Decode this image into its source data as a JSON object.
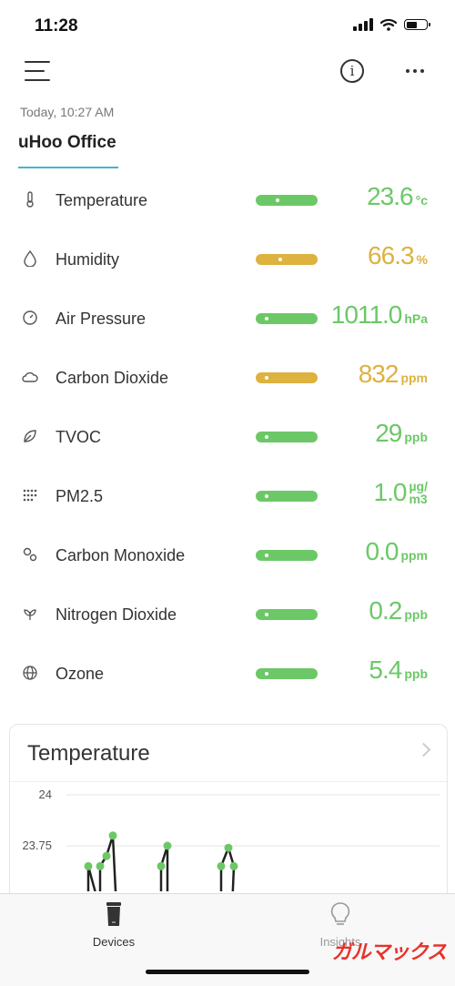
{
  "status_bar": {
    "time": "11:28"
  },
  "header": {
    "timestamp": "Today, 10:27 AM",
    "device_name": "uHoo Office"
  },
  "colors": {
    "green": "#6cc867",
    "yellow": "#ddb23f",
    "accent": "#41b6cf"
  },
  "metrics": [
    {
      "label": "Temperature",
      "value": "23.6",
      "unit": "°c",
      "status": "good",
      "icon": "thermometer-icon",
      "level": 0.3
    },
    {
      "label": "Humidity",
      "value": "66.3",
      "unit": "%",
      "status": "moderate",
      "icon": "droplet-icon",
      "level": 0.35
    },
    {
      "label": "Air Pressure",
      "value": "1011.0",
      "unit": "hPa",
      "status": "good",
      "icon": "gauge-icon",
      "level": 0.1
    },
    {
      "label": "Carbon Dioxide",
      "value": "832",
      "unit": "ppm",
      "status": "moderate",
      "icon": "cloud-icon",
      "level": 0.1
    },
    {
      "label": "TVOC",
      "value": "29",
      "unit": "ppb",
      "status": "good",
      "icon": "leaf-icon",
      "level": 0.1
    },
    {
      "label": "PM2.5",
      "value": "1.0",
      "unit": "µg/ m3",
      "unit_top": "µg/",
      "unit_bottom": "m3",
      "status": "good",
      "icon": "particles-icon",
      "level": 0.1
    },
    {
      "label": "Carbon Monoxide",
      "value": "0.0",
      "unit": "ppm",
      "status": "good",
      "icon": "molecule-icon",
      "level": 0.1
    },
    {
      "label": "Nitrogen Dioxide",
      "value": "0.2",
      "unit": "ppb",
      "status": "good",
      "icon": "plant-icon",
      "level": 0.1
    },
    {
      "label": "Ozone",
      "value": "5.4",
      "unit": "ppb",
      "status": "good",
      "icon": "globe-icon",
      "level": 0.1
    }
  ],
  "chart_card": {
    "title": "Temperature",
    "y_ticks": [
      "24",
      "23.75"
    ]
  },
  "chart_data": {
    "type": "line",
    "title": "Temperature",
    "xlabel": "",
    "ylabel": "",
    "ylim": [
      23.5,
      24
    ],
    "grid": true,
    "points": [
      {
        "x": 0,
        "y": 23.65
      },
      {
        "x": 1,
        "y": 23.65
      },
      {
        "x": 2,
        "y": 23.7
      },
      {
        "x": 3,
        "y": 23.8
      },
      {
        "x": 4,
        "y": 23.65
      },
      {
        "x": 5,
        "y": 23.75
      },
      {
        "x": 6,
        "y": 23.65
      },
      {
        "x": 7,
        "y": 23.74
      },
      {
        "x": 8,
        "y": 23.65
      }
    ]
  },
  "tabbar": {
    "devices_label": "Devices",
    "insights_label": "Insights"
  },
  "watermark": "ガルマックス"
}
